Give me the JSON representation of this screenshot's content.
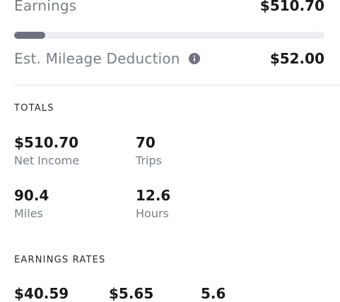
{
  "earnings": {
    "label": "Earnings",
    "value": "$510.70",
    "progress_fraction": 0.1
  },
  "mileage": {
    "label": "Est. Mileage Deduction",
    "value": "$52.00",
    "info_icon": "info-icon"
  },
  "totals": {
    "title": "TOTALS",
    "items": [
      {
        "value": "$510.70",
        "label": "Net Income"
      },
      {
        "value": "70",
        "label": "Trips"
      },
      {
        "value": "90.4",
        "label": "Miles"
      },
      {
        "value": "12.6",
        "label": "Hours"
      }
    ]
  },
  "earnings_rates": {
    "title": "EARNINGS RATES",
    "values": [
      "$40.59",
      "$5.65",
      "5.6"
    ]
  },
  "colors": {
    "progress_track": "#eeeef1",
    "progress_fill": "#6f6f81",
    "muted_text": "#7a7f87",
    "info_icon": "#6f6f81"
  }
}
